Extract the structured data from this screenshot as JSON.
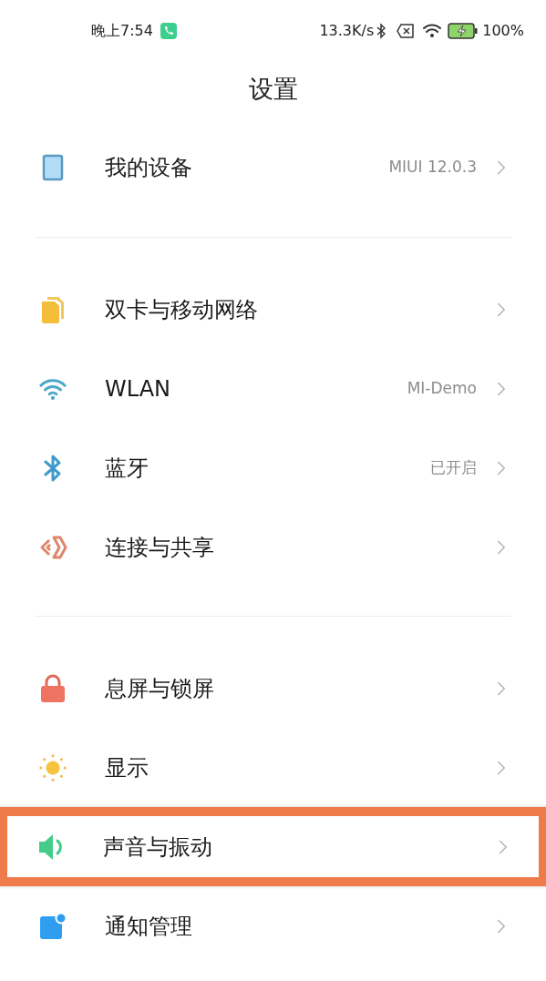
{
  "status_bar": {
    "time": "晚上7:54",
    "speed": "13.3K/s",
    "battery": "100%"
  },
  "title": "设置",
  "sections": [
    {
      "items": [
        {
          "kind": "device",
          "label": "我的设备",
          "value": "MIUI 12.0.3",
          "highlighted": false
        }
      ]
    },
    {
      "items": [
        {
          "kind": "sim",
          "label": "双卡与移动网络",
          "highlighted": false
        },
        {
          "kind": "wifi",
          "label": "WLAN",
          "value": "MI-Demo",
          "highlighted": false
        },
        {
          "kind": "bluetooth",
          "label": "蓝牙",
          "value": "已开启",
          "highlighted": false
        },
        {
          "kind": "share",
          "label": "连接与共享",
          "highlighted": false
        }
      ]
    },
    {
      "items": [
        {
          "kind": "lock",
          "label": "息屏与锁屏",
          "highlighted": false
        },
        {
          "kind": "sun",
          "label": "显示",
          "highlighted": false
        },
        {
          "kind": "sound",
          "label": "声音与振动",
          "highlighted": true
        },
        {
          "kind": "notification",
          "label": "通知管理",
          "highlighted": false
        }
      ]
    }
  ]
}
